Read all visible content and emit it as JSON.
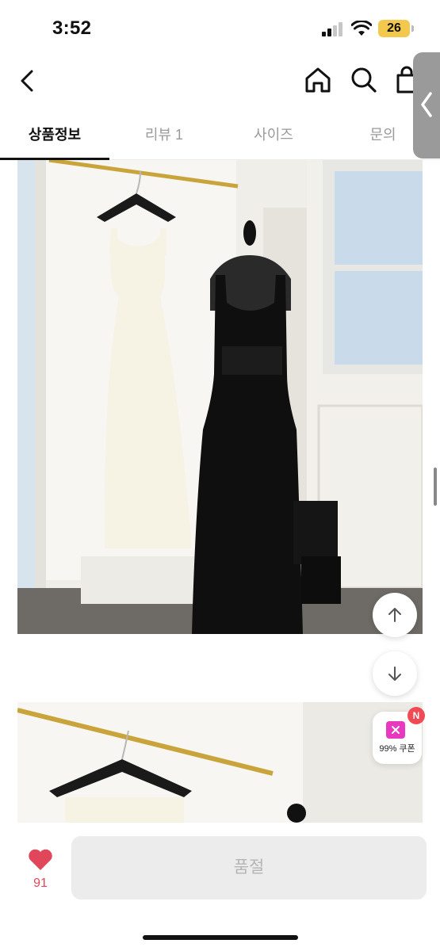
{
  "status_bar": {
    "time": "3:52",
    "battery": "26"
  },
  "nav": {
    "icons": [
      "back-chevron-icon",
      "home-icon",
      "search-icon",
      "shopping-bag-icon"
    ]
  },
  "tabs": [
    {
      "label": "상품정보",
      "active": true
    },
    {
      "label": "리뷰 1",
      "active": false
    },
    {
      "label": "사이즈",
      "active": false
    },
    {
      "label": "문의",
      "active": false
    }
  ],
  "floating": {
    "coupon_badge": "N",
    "coupon_label": "99% 쿠폰"
  },
  "bottom": {
    "like_count": "91",
    "buy_label": "품절"
  },
  "colors": {
    "accent_heart": "#e0475a",
    "coupon_pink": "#e838c0",
    "badge_red": "#f04a55",
    "battery_yellow": "#f2c94c"
  }
}
